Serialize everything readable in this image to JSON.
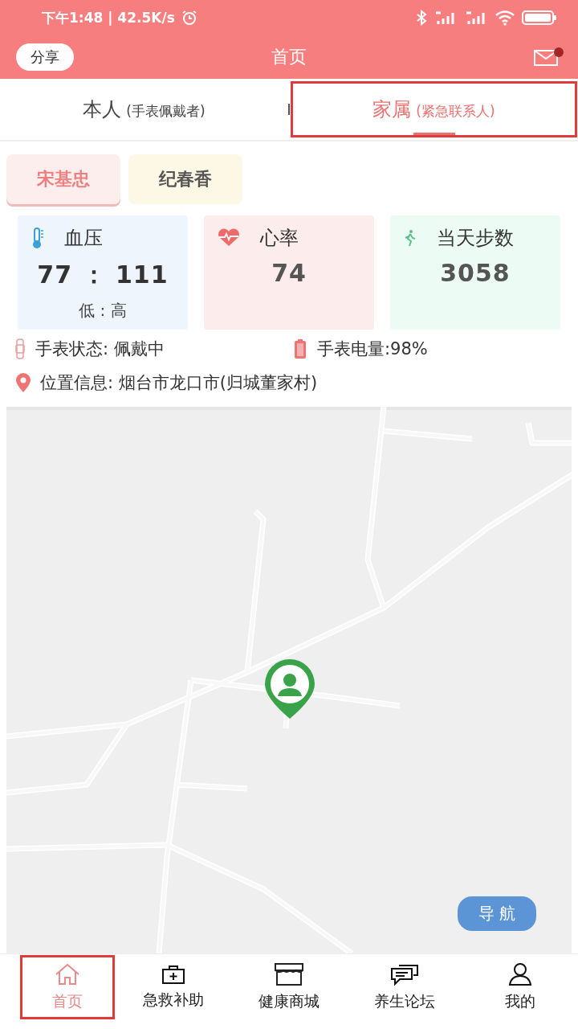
{
  "status_bar": {
    "time": "下午1:48 | 42.5K/s"
  },
  "header": {
    "share": "分享",
    "title": "首页",
    "unread": true
  },
  "tabs": [
    {
      "label": "本人",
      "sub": "(手表佩戴者)",
      "selected": false,
      "highlighted": false
    },
    {
      "label": "家属",
      "sub": "(紧急联系人)",
      "selected": true,
      "highlighted": true
    }
  ],
  "members": [
    {
      "name": "宋基忠",
      "selected": true
    },
    {
      "name": "纪春香",
      "selected": false
    }
  ],
  "cards": [
    {
      "kind": "blood_pressure",
      "label": "血压",
      "value": "77 ： 111",
      "sub": "低 : 高"
    },
    {
      "kind": "heart_rate",
      "label": "心率",
      "value": "74"
    },
    {
      "kind": "steps",
      "label": "当天步数",
      "value": "3058"
    }
  ],
  "watch": {
    "status_label": "手表状态:",
    "status": "佩戴中",
    "battery": "手表电量:98%"
  },
  "location": {
    "label": "位置信息:",
    "value": "烟台市龙口市(归城董家村)"
  },
  "map": {
    "kind": "picture",
    "nav_button": "导 航"
  },
  "nav": [
    {
      "label": "首页",
      "kind": "home",
      "selected": true,
      "highlighted": true
    },
    {
      "label": "急救补助",
      "kind": "aid",
      "selected": false,
      "highlighted": false
    },
    {
      "label": "健康商城",
      "kind": "shop",
      "selected": false,
      "highlighted": false
    },
    {
      "label": "养生论坛",
      "kind": "forum",
      "selected": false,
      "highlighted": false
    },
    {
      "label": "我的",
      "kind": "profile",
      "selected": false,
      "highlighted": false
    }
  ]
}
